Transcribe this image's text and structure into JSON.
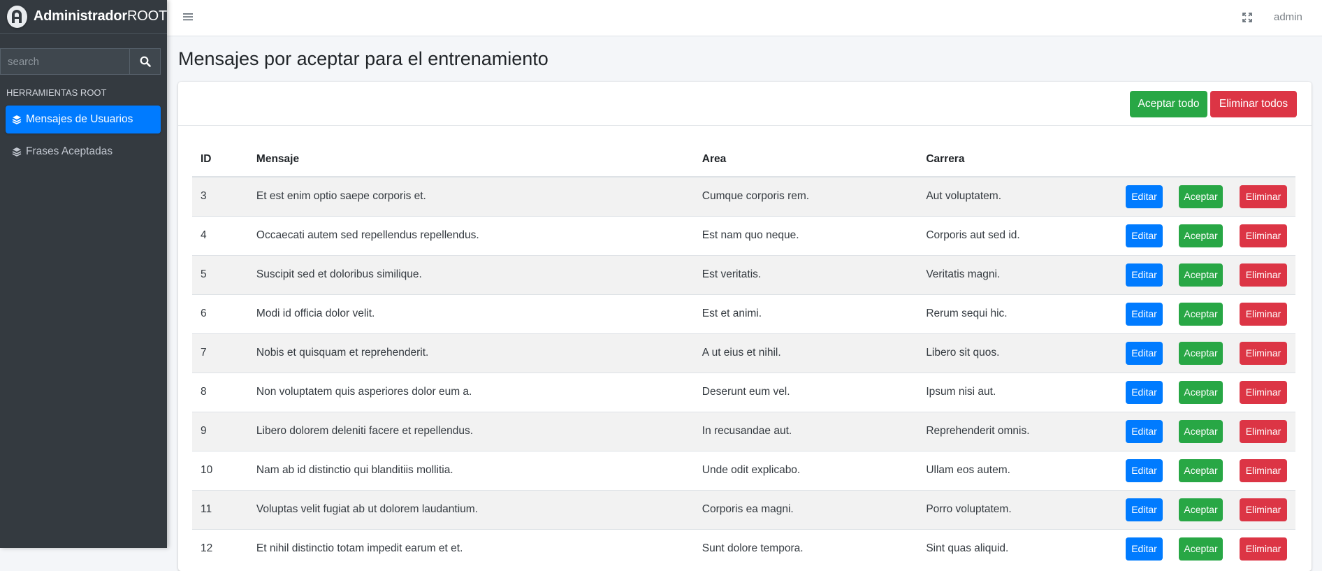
{
  "brand": {
    "name_bold": "Administrador",
    "name_light": "ROOT"
  },
  "sidebar": {
    "search_placeholder": "search",
    "section_header": "HERRAMIENTAS ROOT",
    "items": [
      {
        "label": "Mensajes de Usuarios",
        "active": true
      },
      {
        "label": "Frases Aceptadas",
        "active": false
      }
    ]
  },
  "topbar": {
    "user": "admin"
  },
  "page": {
    "title": "Mensajes por aceptar para el entrenamiento"
  },
  "card": {
    "accept_all": "Aceptar todo",
    "delete_all": "Eliminar todos"
  },
  "table": {
    "headers": [
      "ID",
      "Mensaje",
      "Area",
      "Carrera",
      ""
    ],
    "action_labels": {
      "edit": "Editar",
      "accept": "Aceptar",
      "delete": "Eliminar"
    },
    "rows": [
      {
        "id": "3",
        "mensaje": "Et est enim optio saepe corporis et.",
        "area": "Cumque corporis rem.",
        "carrera": "Aut voluptatem."
      },
      {
        "id": "4",
        "mensaje": "Occaecati autem sed repellendus repellendus.",
        "area": "Est nam quo neque.",
        "carrera": "Corporis aut sed id."
      },
      {
        "id": "5",
        "mensaje": "Suscipit sed et doloribus similique.",
        "area": "Est veritatis.",
        "carrera": "Veritatis magni."
      },
      {
        "id": "6",
        "mensaje": "Modi id officia dolor velit.",
        "area": "Est et animi.",
        "carrera": "Rerum sequi hic."
      },
      {
        "id": "7",
        "mensaje": "Nobis et quisquam et reprehenderit.",
        "area": "A ut eius et nihil.",
        "carrera": "Libero sit quos."
      },
      {
        "id": "8",
        "mensaje": "Non voluptatem quis asperiores dolor eum a.",
        "area": "Deserunt eum vel.",
        "carrera": "Ipsum nisi aut."
      },
      {
        "id": "9",
        "mensaje": "Libero dolorem deleniti facere et repellendus.",
        "area": "In recusandae aut.",
        "carrera": "Reprehenderit omnis."
      },
      {
        "id": "10",
        "mensaje": "Nam ab id distinctio qui blanditiis mollitia.",
        "area": "Unde odit explicabo.",
        "carrera": "Ullam eos autem."
      },
      {
        "id": "11",
        "mensaje": "Voluptas velit fugiat ab ut dolorem laudantium.",
        "area": "Corporis ea magni.",
        "carrera": "Porro voluptatem."
      },
      {
        "id": "12",
        "mensaje": "Et nihil distinctio totam impedit earum et et.",
        "area": "Sunt dolore tempora.",
        "carrera": "Sint quas aliquid."
      }
    ]
  },
  "colors": {
    "primary": "#007bff",
    "success": "#28a745",
    "danger": "#dc3545",
    "sidebar": "#343a40"
  }
}
